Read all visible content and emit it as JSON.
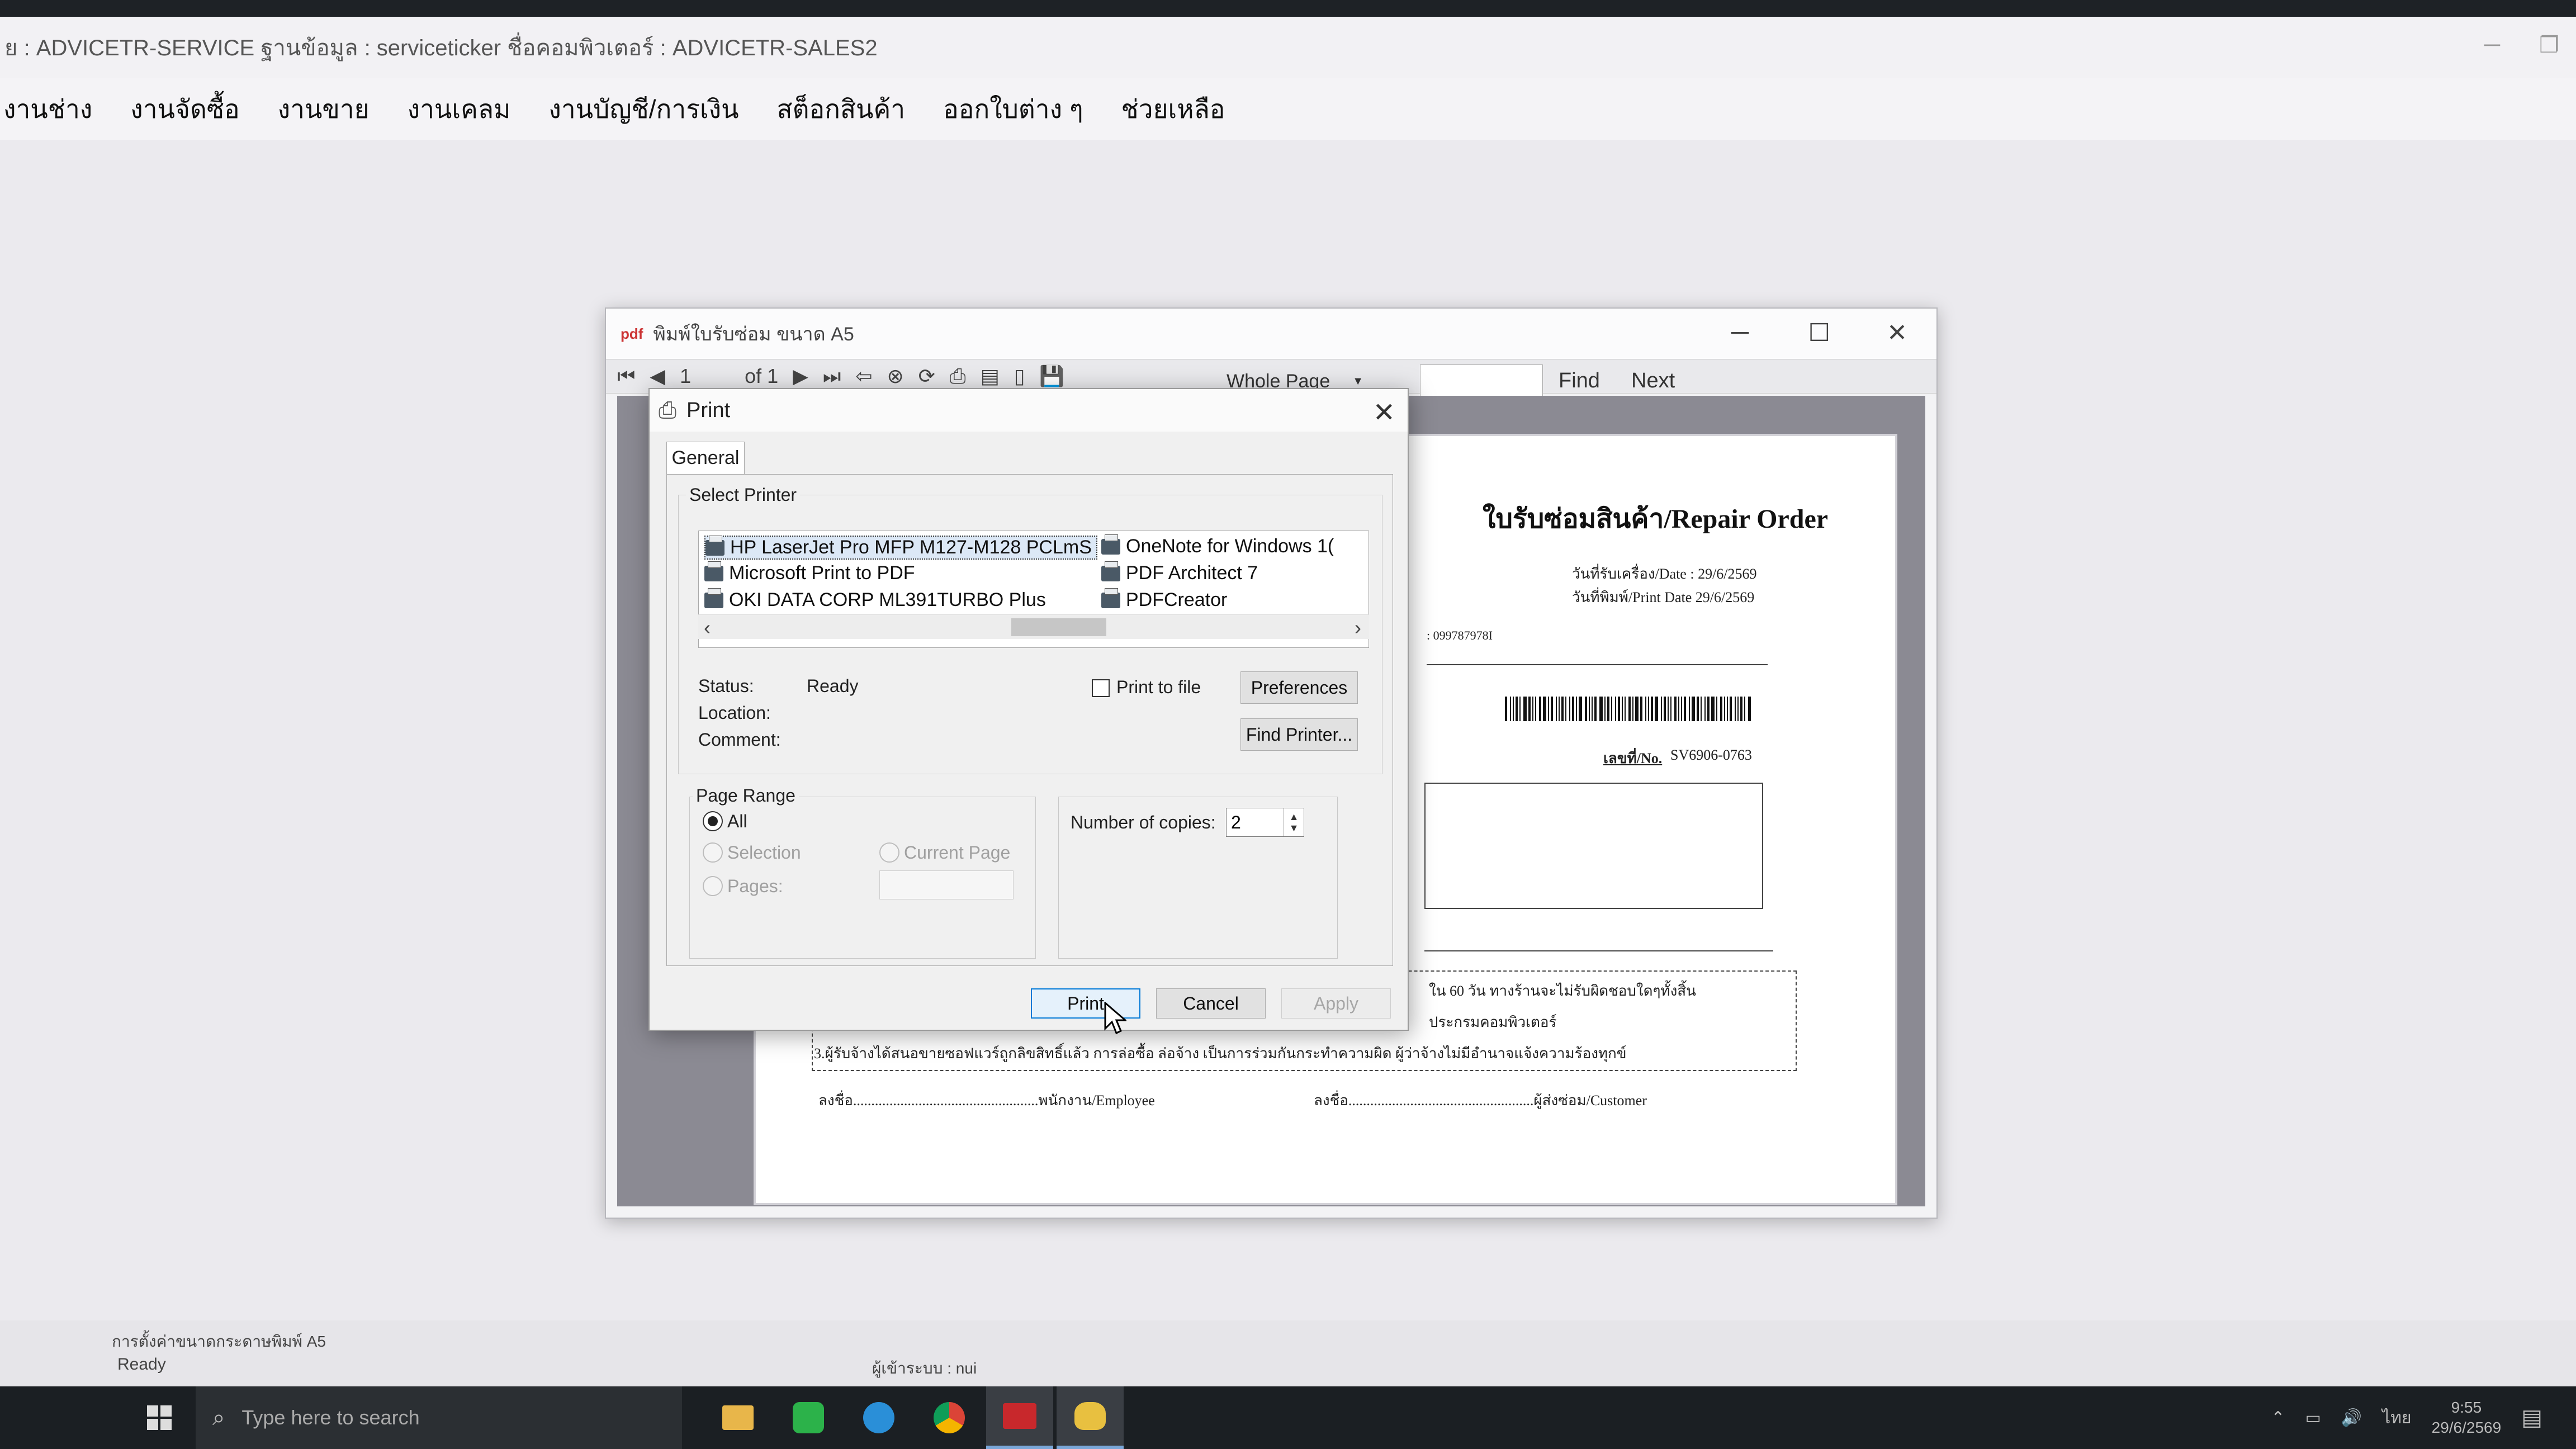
{
  "app": {
    "title": "ย : ADVICETR-SERVICE  ฐานข้อมูล : serviceticker  ชื่อคอมพิวเตอร์ : ADVICETR-SALES2",
    "menu": [
      "งานช่าง",
      "งานจัดซื้อ",
      "งานขาย",
      "งานเคลม",
      "งานบัญชี/การเงิน",
      "สต็อกสินค้า",
      "ออกใบต่าง ๆ",
      "ช่วยเหลือ"
    ],
    "status_message": "การตั้งค่าขนาดกระดาษพิมพ์ A5",
    "status_ready": "Ready",
    "status_user": "ผู้เข้าระบบ : nui"
  },
  "viewer": {
    "title": "พิมพ์ใบรับซ่อม ขนาด A5",
    "page_current": "1",
    "page_of": "of 1",
    "zoom": "Whole Page",
    "find_label": "Find",
    "next_label": "Next"
  },
  "document": {
    "title": "ใบรับซ่อมสินค้า/Repair Order",
    "receive_date": "วันที่รับเครื่อง/Date : 29/6/2569",
    "print_date": "วันที่พิมพ์/Print Date 29/6/2569",
    "phone": ": 099787978I",
    "doc_no_label": "เลขที่/No.",
    "doc_no_value": "SV6906-0763",
    "term_1": "ใน 60 วัน ทางร้านจะไม่รับผิดชอบใดๆทั้งสิ้น",
    "term_2": "ประกรมคอมพิวเตอร์",
    "term_3": "3.ผู้รับจ้างได้สนอขายซอฟแวร์ถูกลิขสิทธิ์แล้ว การล่อซื้อ ล่อจ้าง  เป็นการร่วมกันกระทำความผิด ผู้ว่าจ้างไม่มีอำนาจแจ้งความร้องทุกข์",
    "sign_employee": "ลงชื่อ...................................................พนักงาน/Employee",
    "sign_customer": "ลงชื่อ...................................................ผู้ส่งซ่อม/Customer"
  },
  "print_dialog": {
    "title": "Print",
    "tab_general": "General",
    "select_printer_label": "Select Printer",
    "printers": [
      {
        "name": "HP LaserJet Pro MFP M127-M128 PCLmS",
        "selected": true
      },
      {
        "name": "Microsoft Print to PDF",
        "selected": false
      },
      {
        "name": "OKI DATA CORP ML391TURBO Plus",
        "selected": false
      },
      {
        "name": "OneNote for Windows 1(",
        "selected": false
      },
      {
        "name": "PDF Architect 7",
        "selected": false
      },
      {
        "name": "PDFCreator",
        "selected": false
      }
    ],
    "status_label": "Status:",
    "status_value": "Ready",
    "location_label": "Location:",
    "comment_label": "Comment:",
    "print_to_file_label": "Print to file",
    "preferences_label": "Preferences",
    "find_printer_label": "Find Printer...",
    "page_range_label": "Page Range",
    "range_all": "All",
    "range_selection": "Selection",
    "range_current_page": "Current Page",
    "range_pages": "Pages:",
    "copies_label": "Number of copies:",
    "copies_value": "2",
    "print_button": "Print",
    "cancel_button": "Cancel",
    "apply_button": "Apply"
  },
  "taskbar": {
    "search_placeholder": "Type here to search",
    "language": "ไทย",
    "time": "9:55",
    "date": "29/6/2569"
  }
}
